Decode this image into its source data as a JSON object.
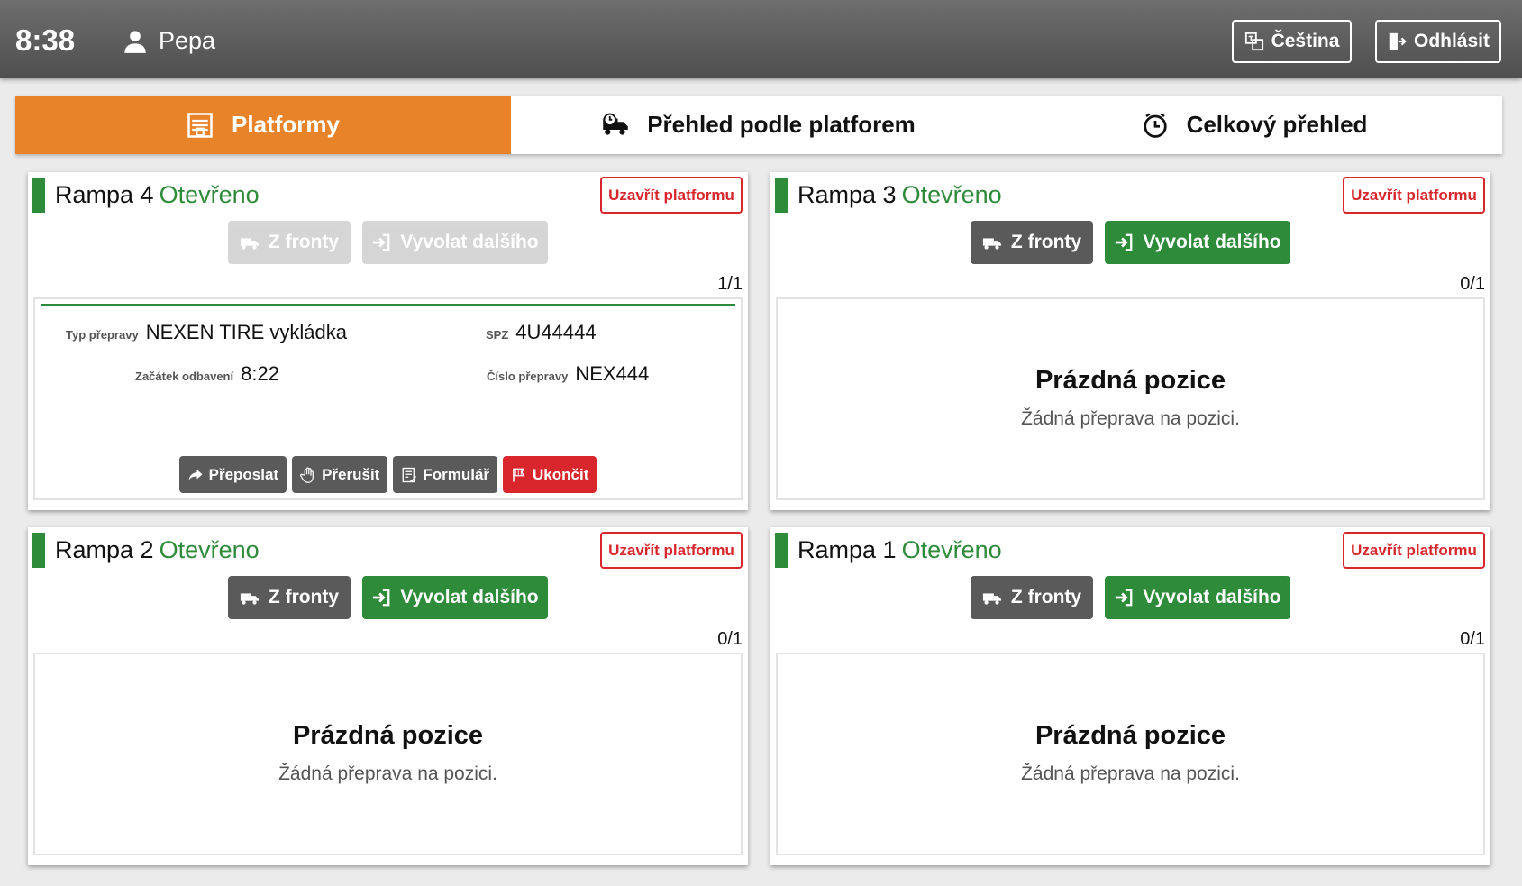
{
  "header": {
    "time": "8:38",
    "user": "Pepa",
    "language_label": "Čeština",
    "logout_label": "Odhlásit"
  },
  "tabs": [
    {
      "label": "Platformy",
      "active": true
    },
    {
      "label": "Přehled podle platforem",
      "active": false
    },
    {
      "label": "Celkový přehled",
      "active": false
    }
  ],
  "common": {
    "close_platform": "Uzavřít platformu",
    "from_queue": "Z fronty",
    "call_next": "Vyvolat dalšího",
    "empty_title": "Prázdná pozice",
    "empty_sub": "Žádná přeprava na pozici."
  },
  "ramps": [
    {
      "name": "Rampa 4",
      "status": "Otevřeno",
      "count": "1/1",
      "disabled": true,
      "transport": {
        "type_label": "Typ přepravy",
        "type_value": "NEXEN TIRE vykládka",
        "spz_label": "SPZ",
        "spz_value": "4U44444",
        "start_label": "Začátek odbavení",
        "start_value": "8:22",
        "number_label": "Číslo přepravy",
        "number_value": "NEX444",
        "actions": [
          "Přeposlat",
          "Přerušit",
          "Formulář",
          "Ukončit"
        ]
      }
    },
    {
      "name": "Rampa 3",
      "status": "Otevřeno",
      "count": "0/1",
      "disabled": false
    },
    {
      "name": "Rampa 2",
      "status": "Otevřeno",
      "count": "0/1",
      "disabled": false
    },
    {
      "name": "Rampa 1",
      "status": "Otevřeno",
      "count": "0/1",
      "disabled": false
    }
  ],
  "colors": {
    "accent_orange": "#e8832a",
    "success_green": "#2e8b3a",
    "danger_red": "#d9262c",
    "dark_gray": "#5a5a5a"
  }
}
